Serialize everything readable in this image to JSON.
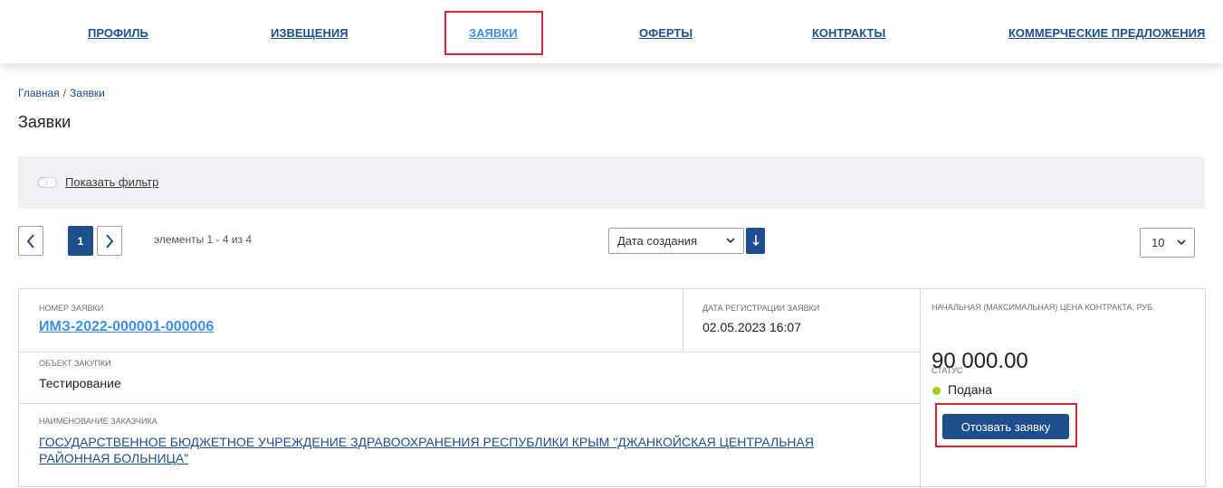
{
  "nav": {
    "items": [
      {
        "label": "ПРОФИЛЬ"
      },
      {
        "label": "ИЗВЕЩЕНИЯ"
      },
      {
        "label": "ЗАЯВКИ"
      },
      {
        "label": "ОФЕРТЫ"
      },
      {
        "label": "КОНТРАКТЫ"
      },
      {
        "label": "КОММЕРЧЕСКИЕ ПРЕДЛОЖЕНИЯ"
      }
    ],
    "active_item": "ЗАЯВКИ"
  },
  "breadcrumb": {
    "home": "Главная",
    "separator": "/",
    "current": "Заявки"
  },
  "page_title": "Заявки",
  "filter": {
    "toggle_on": false,
    "label": "Показать фильтр"
  },
  "pagination": {
    "current_page": "1",
    "info": "элементы 1 - 4 из 4"
  },
  "sort": {
    "field": "Дата создания",
    "direction": "desc"
  },
  "per_page": "10",
  "application": {
    "number_label": "НОМЕР ЗАЯВКИ",
    "number": "ИМЗ-2022-000001-000006",
    "reg_date_label": "ДАТА РЕГИСТРАЦИИ ЗАЯВКИ",
    "reg_date": "02.05.2023 16:07",
    "object_label": "ОБЪЕКТ ЗАКУПКИ",
    "object": "Тестирование",
    "customer_label": "НАИМЕНОВАНИЕ ЗАКАЗЧИКА",
    "customer": "ГОСУДАРСТВЕННОЕ БЮДЖЕТНОЕ УЧРЕЖДЕНИЕ ЗДРАВООХРАНЕНИЯ РЕСПУБЛИКИ КРЫМ \"ДЖАНКОЙСКАЯ ЦЕНТРАЛЬНАЯ РАЙОННАЯ БОЛЬНИЦА\"",
    "price_label": "НАЧАЛЬНАЯ (МАКСИМАЛЬНАЯ) ЦЕНА КОНТРАКТА, РУБ.",
    "price": "90 000.00",
    "status_label": "СТАТУС",
    "status": "Подана",
    "status_color": "#a6c91b",
    "withdraw_label": "Отозвать заявку"
  },
  "colors": {
    "primary": "#1f4e8c",
    "link_active": "#3e8ee6",
    "highlight": "#d8262e"
  }
}
